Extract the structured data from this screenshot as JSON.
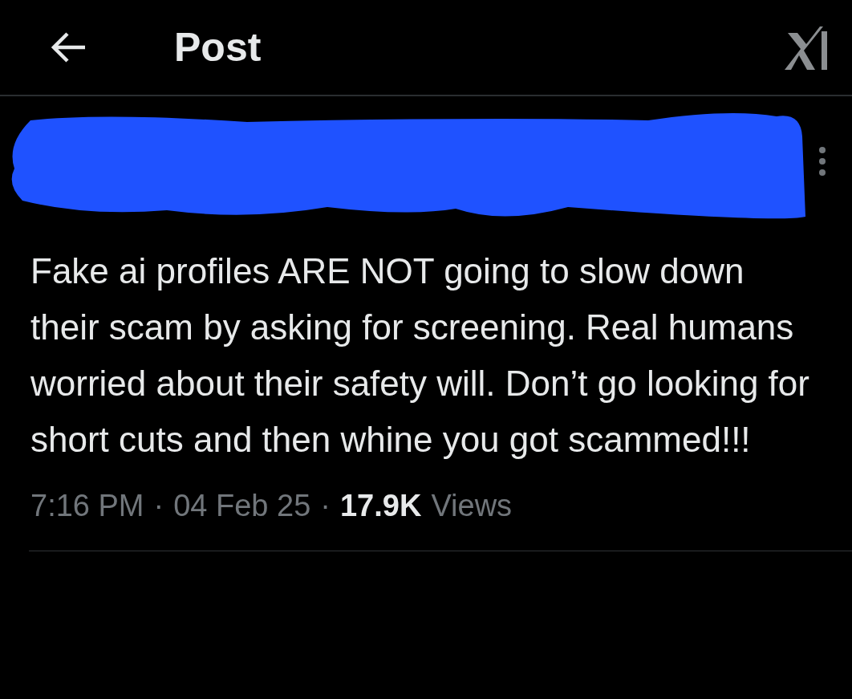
{
  "header": {
    "title": "Post"
  },
  "author": {
    "redacted": true
  },
  "post": {
    "text": "Fake ai profiles ARE NOT going to slow down their scam by asking for screening. Real humans worried about their safety will. Don’t go looking for short cuts and then whine you got scammed!!!",
    "time": "7:16 PM",
    "separator_1": "·",
    "date": "04 Feb 25",
    "separator_2": "·",
    "views_count": "17.9K",
    "views_label": "Views"
  }
}
